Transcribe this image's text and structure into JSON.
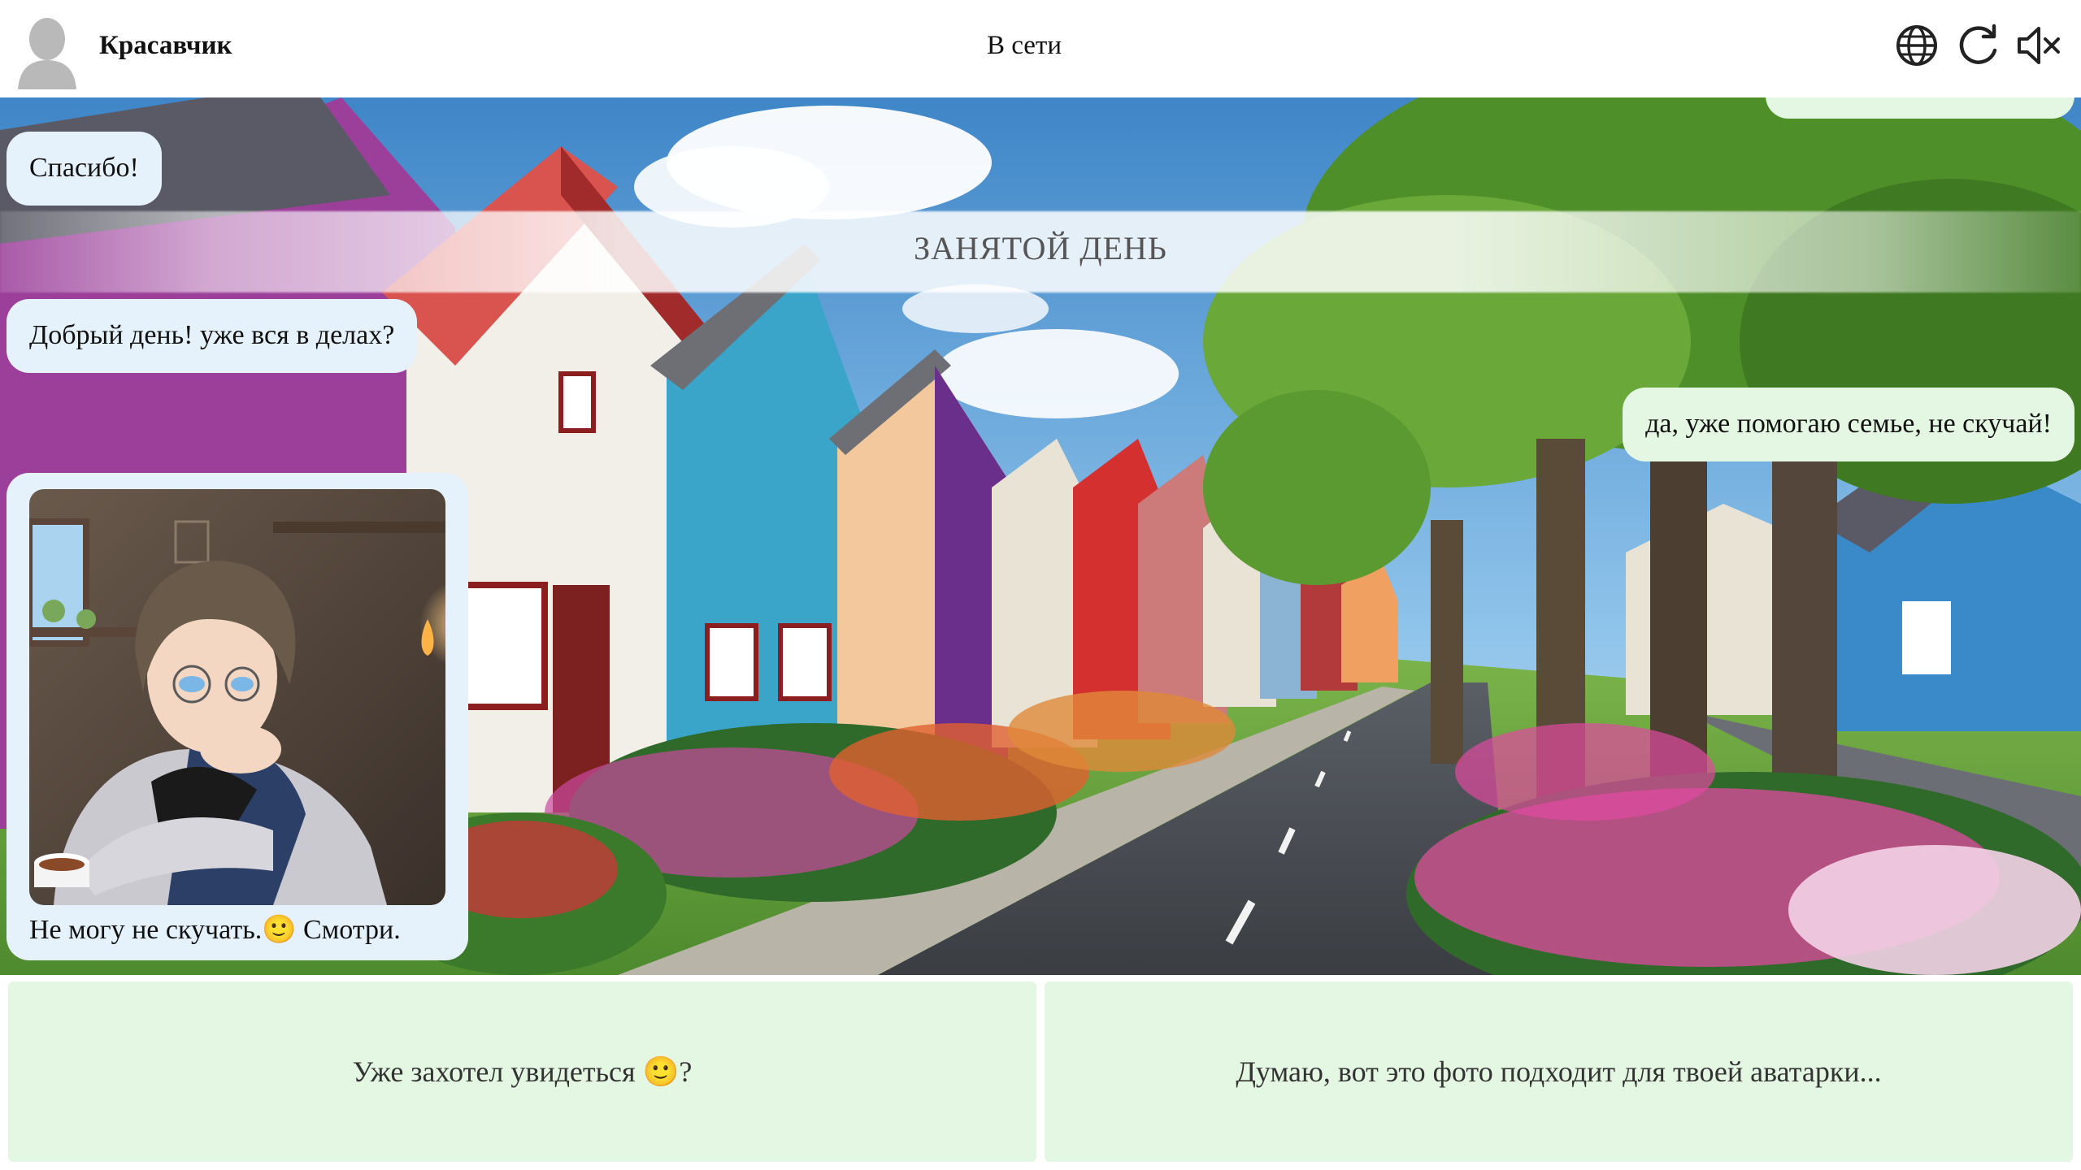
{
  "header": {
    "contact_name": "Красавчик",
    "status": "В сети",
    "icons": [
      "globe-icon",
      "refresh-icon",
      "speaker-muted-icon"
    ]
  },
  "chat": {
    "messages": [
      {
        "side": "in",
        "text": "Спасибо!"
      },
      {
        "type": "date-divider",
        "text": "ЗАНЯТОЙ ДЕНЬ"
      },
      {
        "side": "in",
        "text": "Добрый день! уже вся в делах?"
      },
      {
        "side": "out",
        "text": "да, уже помогаю семье, не скучай!"
      },
      {
        "side": "in",
        "type": "photo",
        "caption": "Не могу не скучать.🙂 Смотри."
      }
    ]
  },
  "replies": [
    {
      "text": "Уже захотел увидеться 🙂?"
    },
    {
      "text": "Думаю, вот это фото подходит для твоей аватарки..."
    }
  ],
  "colors": {
    "incoming_bubble": "#e6f2fb",
    "outgoing_bubble": "#e4f7e2",
    "reply_button": "#e4f7e2"
  }
}
